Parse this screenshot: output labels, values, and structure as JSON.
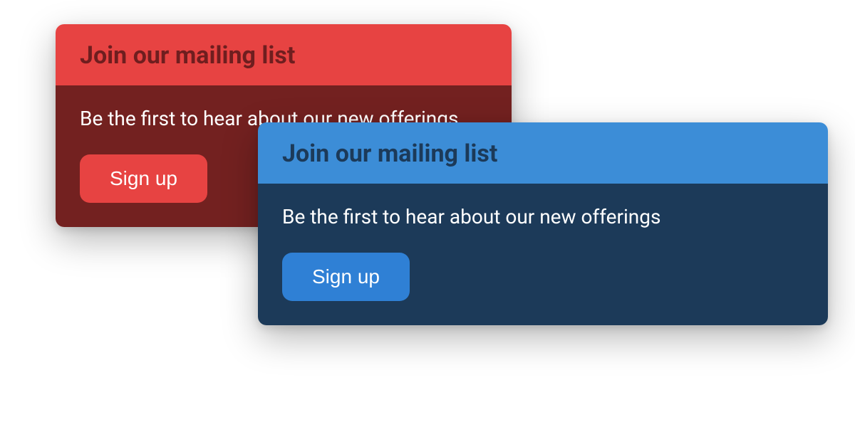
{
  "cards": {
    "red": {
      "title": "Join our mailing list",
      "body_text": "Be the first to hear about our new offerings",
      "button_label": "Sign up"
    },
    "blue": {
      "title": "Join our mailing list",
      "body_text": "Be the first to hear about our new offerings",
      "button_label": "Sign up"
    }
  },
  "colors": {
    "red_accent": "#e74342",
    "red_dark": "#732120",
    "blue_accent": "#3c8dd7",
    "blue_button": "#2f80d5",
    "blue_dark": "#1c3a59"
  }
}
